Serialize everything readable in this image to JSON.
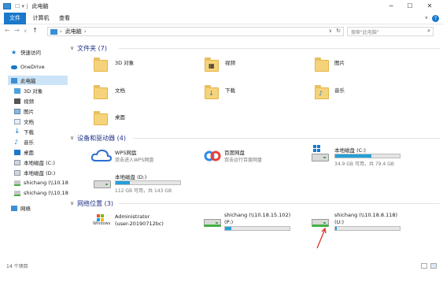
{
  "window": {
    "title": "此电脑",
    "quick_access_icons": "☐ ▾ |"
  },
  "controls": {
    "minimize": "−",
    "maximize": "☐",
    "close": "✕"
  },
  "ribbon": {
    "tabs": [
      "文件",
      "计算机",
      "查看"
    ],
    "help": "?"
  },
  "address": {
    "path": "此电脑",
    "sep": "›",
    "dropdown": "∨",
    "refresh": "↻"
  },
  "search": {
    "placeholder": "搜索\"此电脑\"",
    "icon": "⌕"
  },
  "nav": {
    "items": [
      {
        "label": "快速访问"
      },
      {
        "label": "OneDrive"
      },
      {
        "label": "此电脑"
      },
      {
        "label": "3D 对象"
      },
      {
        "label": "视频"
      },
      {
        "label": "图片"
      },
      {
        "label": "文档"
      },
      {
        "label": "下载"
      },
      {
        "label": "音乐"
      },
      {
        "label": "桌面"
      },
      {
        "label": "本地磁盘 (C:)"
      },
      {
        "label": "本地磁盘 (D:)"
      },
      {
        "label": "shichang (\\\\10.18"
      },
      {
        "label": "shichang (\\\\10.18"
      },
      {
        "label": "网络"
      }
    ]
  },
  "groups": {
    "folders": {
      "title": "文件夹 (7)"
    },
    "drives": {
      "title": "设备和驱动器 (4)"
    },
    "network": {
      "title": "网络位置 (3)"
    }
  },
  "folders": [
    {
      "label": "3D 对象",
      "glyph": ""
    },
    {
      "label": "视频",
      "glyph": "▦"
    },
    {
      "label": "图片",
      "glyph": ""
    },
    {
      "label": "文档",
      "glyph": ""
    },
    {
      "label": "下载",
      "glyph": "↓"
    },
    {
      "label": "音乐",
      "glyph": "♪"
    },
    {
      "label": "桌面",
      "glyph": ""
    }
  ],
  "drives": {
    "wps": {
      "name": "WPS网盘",
      "sub": "双击进入WPS网盘"
    },
    "baidu": {
      "name": "百度网盘",
      "sub": "双击运行百度网盘"
    },
    "c": {
      "name": "本地磁盘 (C:)",
      "sub": "34.9 GB 可用，共 79.4 GB",
      "used_fraction": 0.56
    },
    "d": {
      "name": "本地磁盘 (D:)",
      "sub": "112 GB 可用，共 143 GB",
      "used_fraction": 0.22
    }
  },
  "network": {
    "admin": {
      "name": "Administrator",
      "sub": "(user-20190712bc)",
      "logo": "Windows"
    },
    "p": {
      "name": "shichang (\\\\10.18.15.102)",
      "sub": "(P:)",
      "used_fraction": 0.1
    },
    "u": {
      "name": "shichang (\\\\10.18.8.118)",
      "sub": "(U:)",
      "used_fraction": 0.03
    }
  },
  "status": {
    "left": "14 个项目"
  },
  "colors": {
    "accent": "#1979ca",
    "group_title": "#1e3287",
    "bar_fill": "#26a0da",
    "selection": "#cce4f7",
    "annotation_arrow": "#e0302a"
  }
}
